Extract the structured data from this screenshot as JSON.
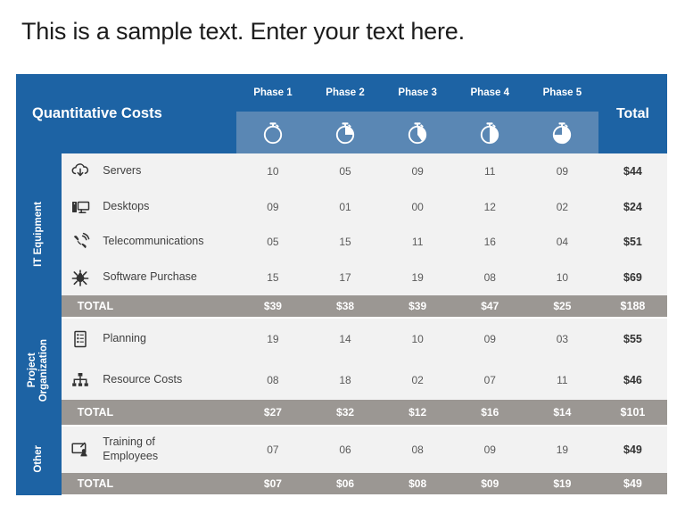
{
  "slide": {
    "title": "This is a sample text. Enter your text here."
  },
  "colors": {
    "header_blue": "#1d63a4",
    "header_icon_blue": "#5a87b4",
    "band_blue": "#1d63a4",
    "total_gray": "#9b9793",
    "cell_gray": "#f2f2f2",
    "text_dark": "#404040",
    "white": "#ffffff"
  },
  "table": {
    "corner_title": "Quantitative Costs",
    "total_header": "Total",
    "phase_headers": [
      {
        "label": "Phase 1",
        "icon": "stopwatch-icon",
        "fill_percent": 0
      },
      {
        "label": "Phase 2",
        "icon": "stopwatch-icon",
        "fill_percent": 25
      },
      {
        "label": "Phase 3",
        "icon": "stopwatch-icon",
        "fill_percent": 40
      },
      {
        "label": "Phase 4",
        "icon": "stopwatch-icon",
        "fill_percent": 50
      },
      {
        "label": "Phase 5",
        "icon": "stopwatch-icon",
        "fill_percent": 75
      }
    ],
    "total_row_label": "TOTAL",
    "sections": [
      {
        "band_label": "IT Equipment",
        "rows": [
          {
            "icon": "cloud-download-icon",
            "label": "Servers",
            "values": [
              "10",
              "05",
              "09",
              "11",
              "09"
            ],
            "total": "$44"
          },
          {
            "icon": "desktop-computer-icon",
            "label": "Desktops",
            "values": [
              "09",
              "01",
              "00",
              "12",
              "02"
            ],
            "total": "$24"
          },
          {
            "icon": "telephone-icon",
            "label": "Telecommunications",
            "values": [
              "05",
              "15",
              "11",
              "16",
              "04"
            ],
            "total": "$51"
          },
          {
            "icon": "software-bug-icon",
            "label": "Software Purchase",
            "values": [
              "15",
              "17",
              "19",
              "08",
              "10"
            ],
            "total": "$69"
          }
        ],
        "totals": {
          "values": [
            "$39",
            "$38",
            "$39",
            "$47",
            "$25"
          ],
          "total": "$188"
        }
      },
      {
        "band_label": "Project\nOrganization",
        "rows": [
          {
            "icon": "checklist-icon",
            "label": "Planning",
            "values": [
              "19",
              "14",
              "10",
              "09",
              "03"
            ],
            "total": "$55"
          },
          {
            "icon": "org-chart-icon",
            "label": "Resource Costs",
            "values": [
              "08",
              "18",
              "02",
              "07",
              "11"
            ],
            "total": "$46"
          }
        ],
        "totals": {
          "values": [
            "$27",
            "$32",
            "$12",
            "$16",
            "$14"
          ],
          "total": "$101"
        }
      },
      {
        "band_label": "Other",
        "rows": [
          {
            "icon": "presentation-training-icon",
            "label": "Training of\nEmployees",
            "values": [
              "07",
              "06",
              "08",
              "09",
              "19"
            ],
            "total": "$49"
          }
        ],
        "totals": {
          "values": [
            "$07",
            "$06",
            "$08",
            "$09",
            "$19"
          ],
          "total": "$49"
        }
      }
    ]
  }
}
